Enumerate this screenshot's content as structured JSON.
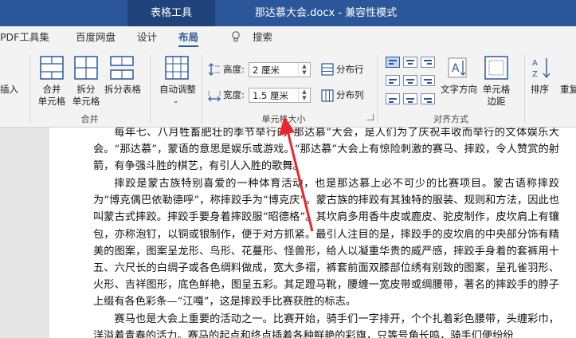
{
  "titlebar": {
    "context_tab": "表格工具",
    "doc_title": "那达慕大会.docx  -  兼容性模式"
  },
  "tabs": [
    {
      "label": "PDF工具集"
    },
    {
      "label": "百度网盘"
    },
    {
      "label": "设计"
    },
    {
      "label": "布局"
    },
    {
      "label": "搜索"
    }
  ],
  "ribbon": {
    "left_partial": "插入",
    "merge_group": {
      "label": "合并",
      "merge_cells": [
        "合并",
        "单元格"
      ],
      "split_cells": [
        "拆分",
        "单元格"
      ],
      "split_table": "拆分表格"
    },
    "autofit": "自动调整",
    "cell_size_group": {
      "label": "单元格大小",
      "height_label": "高度:",
      "height_value": "2 厘米",
      "width_label": "宽度:",
      "width_value": "1.5 厘米",
      "distribute_rows": "分布行",
      "distribute_cols": "分布列"
    },
    "alignment_group": {
      "label": "对齐方式",
      "text_direction": "文字方向",
      "cell_margins": [
        "单元格",
        "边距"
      ]
    },
    "sort": "排序",
    "partial_right": "重复"
  },
  "document": {
    "paragraphs": [
      "每年七、八月牲畜肥壮的季节举行的“那达慕”大会，是人们为了庆祝丰收而举行的文体娱乐大会。“那达慕”，蒙语的意思是娱乐或游戏。“那达慕”大会上有惊险刺激的赛马、摔跤，令人赞赏的射箭，有争强斗胜的棋艺，有引人入胜的歌舞。",
      "摔跤是蒙古族特别喜爱的一种体育活动，也是那达慕上必不可少的比赛项目。蒙古语称摔跤为“博克偶巴依勒德呼”，称摔跤手为“博克庆”。蒙古族的摔跤有其独特的服装、规则和方法，因此也叫蒙古式摔跤。摔跤手要身着摔跤服“昭德格”。其坎肩多用香牛皮或鹿皮、驼皮制作，皮坎肩上有镶包，亦称泡钉，以铜或银制作，便于对方抓紧。最引人注目的是，摔跤手的皮坎肩的中央部分饰有精美的图案，图案呈龙形、鸟形、花蔓形、怪兽形，给人以凝重华贵的威严感，摔跤手身着的套裤用十五、六尺长的白绸子或各色绸料做成，宽大多褶，裤套前面双膝部位绣有别致的图案，呈孔雀羽形、火形、吉祥图形，底色鲜艳，图呈五彩。其足蹬马靴，腰缠一宽皮带或绸腰带，著名的摔跤手的脖子上缀有各色彩条—“江嘎”，这是摔跤手比赛获胜的标志。",
      "赛马也是大会上重要的活动之一。比赛开始，骑手们一字排开，个个扎着彩色腰带，头缠彩巾，洋溢着青春的活力。赛马的起点和终点插着各种鲜艳的彩旗，只等号角长鸣，骑手们便纷纷"
    ]
  },
  "colors": {
    "brand": "#2b579a",
    "annotation": "#e8262e"
  }
}
